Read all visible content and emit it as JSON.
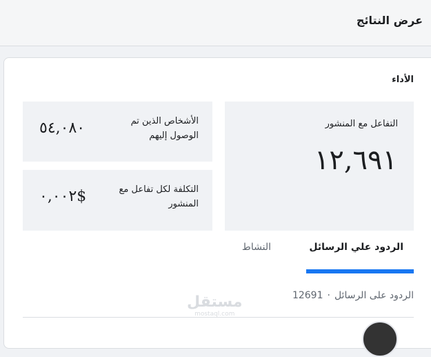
{
  "header": {
    "title": "عرض النتائج"
  },
  "performance": {
    "section_title": "الأداء",
    "post_engagement": {
      "label": "التفاعل مع المنشور",
      "value": "١٢,٦٩١"
    },
    "people_reached": {
      "label": "الأشخاص الذين تم الوصول إليهم",
      "value": "٥٤,٠٨٠"
    },
    "cost_per_engagement": {
      "label": "التكلفة لكل تفاعل مع المنشور",
      "value": "٠,٠٠٢$"
    }
  },
  "tabs": [
    {
      "label": "الردود علي الرسائل",
      "active": true
    },
    {
      "label": "النشاط",
      "active": false
    }
  ],
  "summary": {
    "label": "الردود على الرسائل",
    "separator": "·",
    "count": "12691"
  },
  "watermark": {
    "main": "مستقل",
    "sub": "mostaql.com"
  },
  "colors": {
    "accent": "#1877f2",
    "panel": "#f0f2f5"
  }
}
